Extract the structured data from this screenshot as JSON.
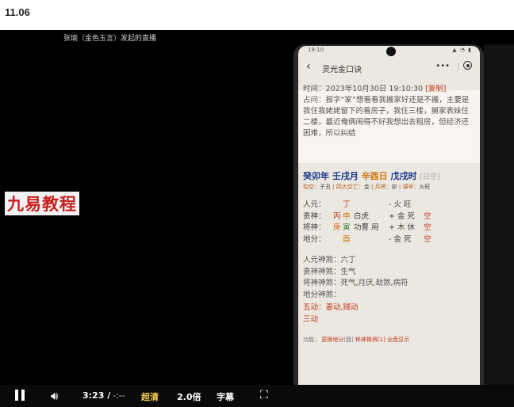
{
  "page": {
    "date": "11.06"
  },
  "video": {
    "live_title": "张瑜（金色玉言）发起的直播",
    "brand_text": "九易教程"
  },
  "phone": {
    "status_time": "19:10",
    "status_icons": "▲ ◔ ▮",
    "nav": {
      "back_icon": "chevron-left-icon",
      "title": "灵光金口诀",
      "more": "•••",
      "target_icon": "target-icon"
    },
    "info": {
      "time_label": "时间：",
      "time_value": "2023年10月30日 19:10:30",
      "copy_label": "[复制]",
      "question_label": "占问：",
      "question_text": "报字“家”想看看我搬家好还是不搬，主要是我住我姥姥留下的看房子，我住三楼，舅家表妹住二楼，最近俺俩闹得不好我想出去租房，但经济还困难，所以纠结"
    },
    "pillars": [
      {
        "text": "癸卯年",
        "color": "navy"
      },
      {
        "text": "壬戌月",
        "color": "navy"
      },
      {
        "text": "辛酉日",
        "color": "orange"
      },
      {
        "text": "戊戌时",
        "color": "navy"
      },
      {
        "text": "[日空]",
        "color": "gray"
      }
    ],
    "sub_info": [
      {
        "label": "旬空：",
        "value": "子丑"
      },
      {
        "label": "四大空亡：",
        "value": "金"
      },
      {
        "label": "月将：",
        "value": "卯"
      },
      {
        "label": "课号：",
        "value": "火旺"
      }
    ],
    "rows": [
      {
        "label": "人元：",
        "stem": "丁",
        "stem_color": "red",
        "branch": "",
        "branch_color": "",
        "god": "",
        "tail": "- 火 旺",
        "tail_extra": ""
      },
      {
        "label": "贵神：",
        "stem": "丙",
        "stem_color": "red",
        "branch": "申",
        "branch_color": "orange",
        "god": "白虎",
        "tail": "+ 金 死",
        "tail_extra": "空"
      },
      {
        "label": "将神：",
        "stem": "庚",
        "stem_color": "orange",
        "branch": "寅",
        "branch_color": "green",
        "god": "功曹 用",
        "tail": "+ 木 休",
        "tail_extra": "空"
      },
      {
        "label": "地分：",
        "stem": "酉",
        "stem_color": "orange",
        "branch": "",
        "branch_color": "",
        "god": "",
        "tail": "- 金 死",
        "tail_extra": "空"
      }
    ],
    "shensha": [
      {
        "label": "人元神煞：",
        "value": "六丁"
      },
      {
        "label": "贵神神煞：",
        "value": "生气"
      },
      {
        "label": "将神神煞：",
        "value": "死气,月厌,劫煞,病符"
      },
      {
        "label": "地分神煞：",
        "value": ""
      }
    ],
    "motion": [
      {
        "label": "五动：",
        "value": "妻动,贼动"
      },
      {
        "label": "三动",
        "value": ""
      }
    ],
    "funcs": {
      "label": "功能：",
      "change_ground": "更换地分",
      "ground_value": "[酉]",
      "move_general": "移神换将[1]",
      "show_all": "全盘显示"
    }
  },
  "controls": {
    "time_current": "3:23 /",
    "time_total": "-:--",
    "quality": "超清",
    "speed": "2.0倍",
    "subtitle": "字幕"
  }
}
